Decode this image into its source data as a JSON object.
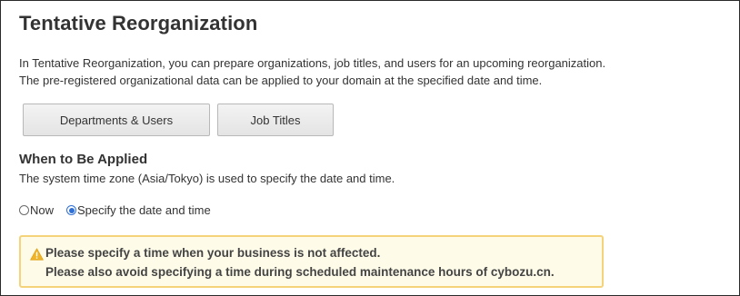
{
  "page": {
    "title": "Tentative Reorganization",
    "description_lines": [
      "In Tentative Reorganization, you can prepare organizations, job titles, and users for an upcoming reorganization.",
      "The pre-registered organizational data can be applied to your domain at the specified date and time."
    ]
  },
  "buttons": {
    "departments_users": "Departments & Users",
    "job_titles": "Job Titles"
  },
  "when_applied": {
    "heading": "When to Be Applied",
    "note": "The system time zone (Asia/Tokyo) is used to specify the date and time.",
    "options": [
      {
        "label": "Now",
        "selected": false
      },
      {
        "label": "Specify the date and time",
        "selected": true
      }
    ]
  },
  "warning": {
    "icon": "warning-triangle-icon",
    "lines": [
      "Please specify a time when your business is not affected.",
      "Please also avoid specifying a time during scheduled maintenance hours of cybozu.cn."
    ]
  },
  "colors": {
    "warning_border": "#f4d37a",
    "warning_background": "#fefbe8",
    "radio_accent": "#2f6fd6"
  }
}
